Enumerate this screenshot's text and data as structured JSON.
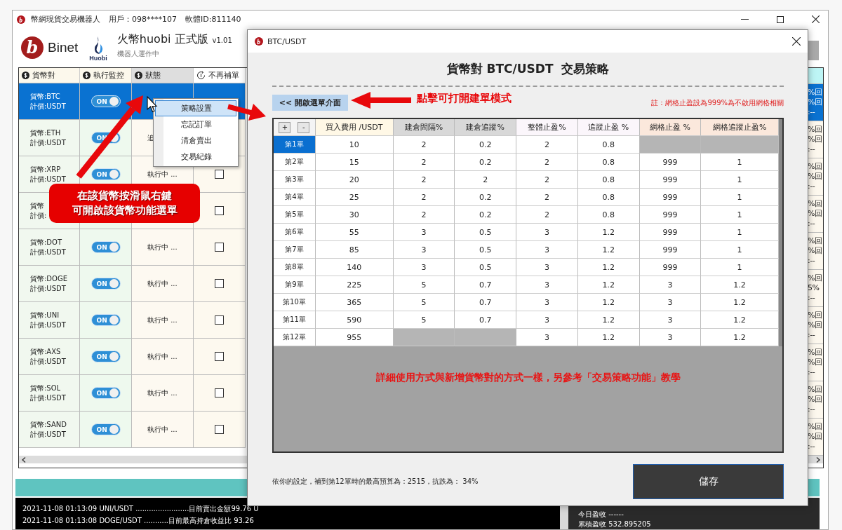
{
  "main_window": {
    "title": "幣網現貨交易機器人",
    "user": "用戶：098****107",
    "software_id": "軟體ID:811140"
  },
  "header": {
    "logo_letter": "b",
    "brand": "Binet",
    "exchange_logo": "Huobi",
    "title": "火幣huobi 正式版",
    "version": "v1.01",
    "subtitle": "機器人運作中"
  },
  "coin_table": {
    "columns": [
      "貨幣對",
      "執行監控",
      "狀態",
      "不再補單"
    ],
    "rows": [
      {
        "pair": "貨幣:BTC",
        "quote": "計價:USDT",
        "selected": true,
        "monitor": {
          "label": "ON",
          "on": true
        },
        "tail": [
          "%回",
          "%回",
          ":--"
        ]
      },
      {
        "pair": "貨幣:ETH",
        "quote": "計價:USDT",
        "selected": false,
        "monitor": {
          "label": "ON",
          "on": true
        },
        "status": "追",
        "tail": [
          "%回",
          "%回",
          ":--"
        ]
      },
      {
        "pair": "貨幣:XRP",
        "quote": "計價:USDT",
        "selected": false,
        "monitor": {
          "label": "ON",
          "on": true
        },
        "status": "執行中 ...",
        "checked": false,
        "tail": [
          "%回",
          "%回",
          ":--"
        ]
      },
      {
        "pair": "貨幣",
        "quote": "計價:",
        "selected": false,
        "checked": false,
        "tail": [
          "%回",
          "%回",
          ":--"
        ]
      },
      {
        "pair": "貨幣:DOT",
        "quote": "計價:USDT",
        "selected": false,
        "monitor": {
          "label": "ON",
          "on": true
        },
        "status": "執行中 ...",
        "checked": false,
        "tail": [
          "%回",
          "%回",
          ":--"
        ]
      },
      {
        "pair": "貨幣:DOGE",
        "quote": "計價:USDT",
        "selected": false,
        "monitor": {
          "label": "ON",
          "on": true
        },
        "status": "執行中 ...",
        "checked": false,
        "tail": [
          "%回",
          "5%",
          ":--"
        ]
      },
      {
        "pair": "貨幣:UNI",
        "quote": "計價:USDT",
        "selected": false,
        "monitor": {
          "label": "ON",
          "on": true
        },
        "status": "執行中 ...",
        "checked": false,
        "tail": [
          "%回",
          "%回",
          ":--"
        ]
      },
      {
        "pair": "貨幣:AXS",
        "quote": "計價:USDT",
        "selected": false,
        "monitor": {
          "label": "ON",
          "on": true
        },
        "status": "執行中 ...",
        "checked": false,
        "tail": [
          "%回",
          "%回",
          ":--"
        ]
      },
      {
        "pair": "貨幣:SOL",
        "quote": "計價:USDT",
        "selected": false,
        "monitor": {
          "label": "ON",
          "on": true
        },
        "status": "執行中 ...",
        "checked": false,
        "tail": [
          "%回",
          "%回",
          ":--"
        ]
      },
      {
        "pair": "貨幣:SAND",
        "quote": "計價:USDT",
        "selected": false,
        "monitor": {
          "label": "ON",
          "on": true
        },
        "status": "執行中 ...",
        "checked": false,
        "tail": [
          "%回",
          "%回",
          ":--"
        ]
      }
    ]
  },
  "log": [
    "2021-11-08 01:13:09 UNI/USDT ........................目前賣出金額99.76 U",
    "2021-11-08 01:13:08 DOGE/USDT ...........目前最高持倉收益比 93.26"
  ],
  "summary": {
    "today": "今日盈收 ------",
    "total": "累積盈收 532.895205"
  },
  "context_menu": {
    "items": [
      {
        "label": "策略設置",
        "selected": true
      },
      {
        "label": "忘記訂單",
        "selected": false
      },
      {
        "label": "清倉賣出",
        "selected": false
      },
      {
        "label": "交易紀錄",
        "selected": false
      }
    ]
  },
  "dialog": {
    "title": "BTC/USDT",
    "heading": "貨幣對 BTC/USDT  交易策略",
    "menu_button": "<< 開啟選單介面",
    "note": "註：網格止盈設為999%為不啟用網格相關",
    "add": "+",
    "remove": "-",
    "columns": [
      "買入費用 /USDT",
      "建倉間隔%",
      "建倉追蹤%",
      "整體止盈%",
      "追蹤止盈 %",
      "網格止盈 %",
      "網格追蹤止盈%"
    ],
    "rows": [
      {
        "label": "第1單",
        "selected": true,
        "cells": [
          "10",
          "2",
          "0.2",
          "2",
          "0.8",
          null,
          null
        ]
      },
      {
        "label": "第2單",
        "selected": false,
        "cells": [
          "15",
          "2",
          "0.2",
          "2",
          "0.8",
          "999",
          "1"
        ]
      },
      {
        "label": "第3單",
        "selected": false,
        "cells": [
          "20",
          "2",
          "2",
          "2",
          "0.8",
          "999",
          "1"
        ]
      },
      {
        "label": "第4單",
        "selected": false,
        "cells": [
          "25",
          "2",
          "0.2",
          "2",
          "0.8",
          "999",
          "1"
        ]
      },
      {
        "label": "第5單",
        "selected": false,
        "cells": [
          "30",
          "2",
          "0.2",
          "2",
          "0.8",
          "999",
          "1"
        ]
      },
      {
        "label": "第6單",
        "selected": false,
        "cells": [
          "55",
          "3",
          "0.5",
          "3",
          "1.2",
          "999",
          "1"
        ]
      },
      {
        "label": "第7單",
        "selected": false,
        "cells": [
          "85",
          "3",
          "0.5",
          "3",
          "1.2",
          "999",
          "1"
        ]
      },
      {
        "label": "第8單",
        "selected": false,
        "cells": [
          "140",
          "3",
          "0.5",
          "3",
          "1.2",
          "999",
          "1"
        ]
      },
      {
        "label": "第9單",
        "selected": false,
        "cells": [
          "225",
          "5",
          "0.7",
          "3",
          "1.2",
          "3",
          "1.2"
        ]
      },
      {
        "label": "第10單",
        "selected": false,
        "cells": [
          "365",
          "5",
          "0.7",
          "3",
          "1.2",
          "3",
          "1.2"
        ]
      },
      {
        "label": "第11單",
        "selected": false,
        "cells": [
          "590",
          "5",
          "0.7",
          "3",
          "1.2",
          "3",
          "1.2"
        ]
      },
      {
        "label": "第12單",
        "selected": false,
        "cells": [
          "955",
          null,
          null,
          "3",
          "1.2",
          "3",
          "1.2"
        ]
      }
    ],
    "hint": "詳細使用方式與新增貨幣對的方式一樣，另參考「交易策略功能」教學",
    "summary": "依你的設定，補到第12單時的最高預算為：2515，抗跌為： 34%",
    "save": "儲存"
  },
  "annotations": [
    {
      "kind": "callout",
      "lines": [
        "在該貨幣按滑鼠右鍵",
        "可開啟該貨幣功能選單"
      ]
    },
    {
      "kind": "label",
      "lines": [
        "點擊可打開建單模式"
      ]
    }
  ]
}
